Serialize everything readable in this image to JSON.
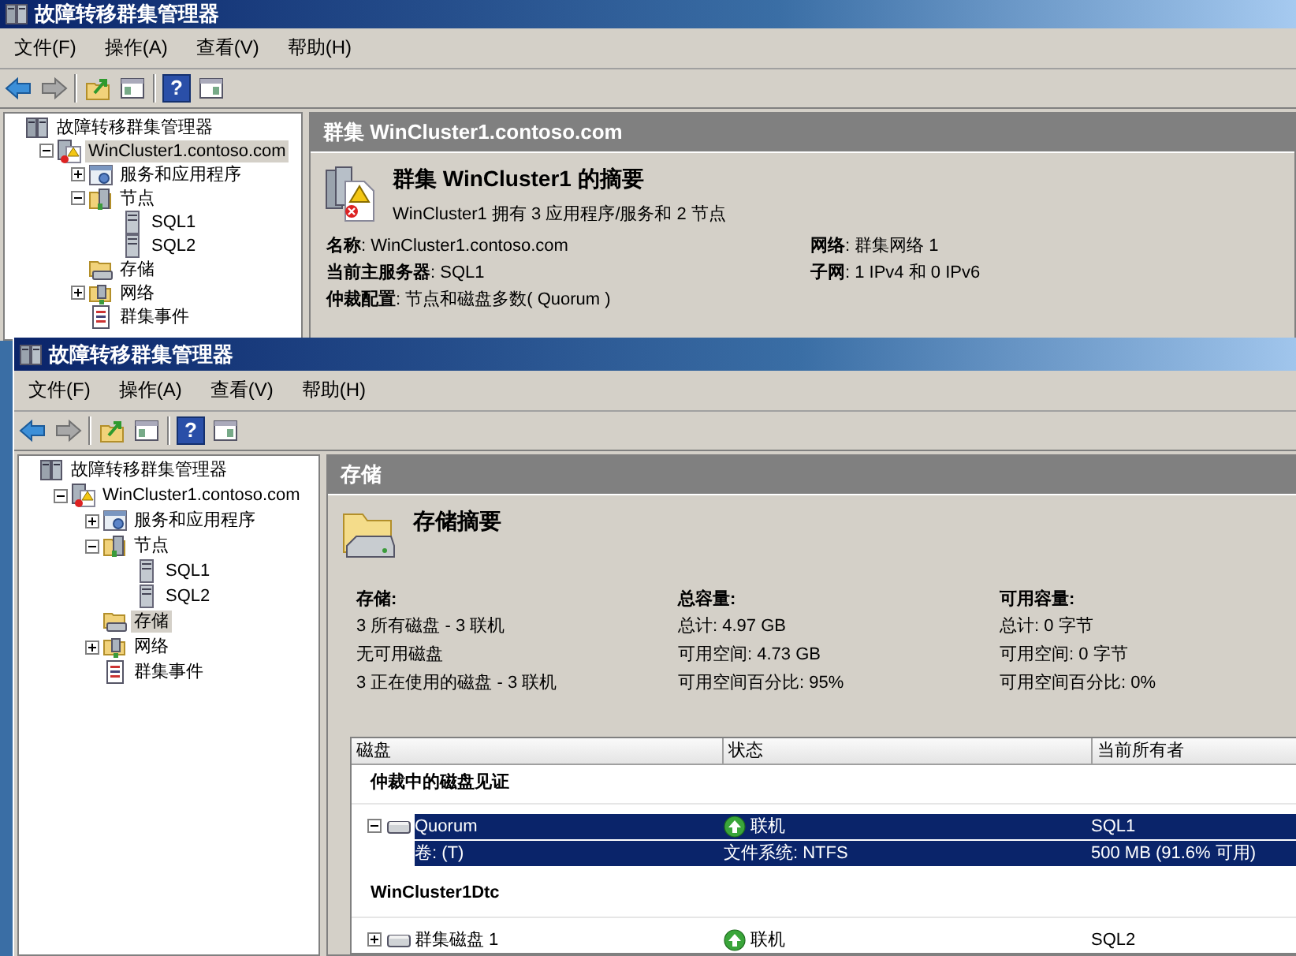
{
  "windows": [
    {
      "title": "故障转移群集管理器",
      "menu": [
        "文件(F)",
        "操作(A)",
        "查看(V)",
        "帮助(H)"
      ],
      "toolbar": [
        {
          "kind": "back"
        },
        {
          "kind": "forward"
        },
        {
          "kind": "sep"
        },
        {
          "kind": "up"
        },
        {
          "kind": "tree"
        },
        {
          "kind": "sep"
        },
        {
          "kind": "help",
          "label": "?"
        },
        {
          "kind": "actions"
        }
      ],
      "tree": [
        {
          "label": "故障转移群集管理器",
          "kind": "manager",
          "selected": false,
          "children": [
            {
              "label": "WinCluster1.contoso.com",
              "kind": "cluster",
              "expanded": true,
              "selected": true,
              "children": [
                {
                  "label": "服务和应用程序",
                  "kind": "services",
                  "expanded": false,
                  "selected": false
                },
                {
                  "label": "节点",
                  "kind": "nodes",
                  "expanded": true,
                  "selected": false,
                  "children": [
                    {
                      "label": "SQL1",
                      "kind": "server",
                      "selected": false
                    },
                    {
                      "label": "SQL2",
                      "kind": "server",
                      "selected": false
                    }
                  ]
                },
                {
                  "label": "存储",
                  "kind": "storage",
                  "selected": false
                },
                {
                  "label": "网络",
                  "kind": "network",
                  "expanded": false,
                  "selected": false
                },
                {
                  "label": "群集事件",
                  "kind": "events",
                  "selected": false
                }
              ]
            }
          ]
        }
      ],
      "pane": {
        "kind": "cluster",
        "header": "群集 WinCluster1.contoso.com",
        "summary_title": "群集 WinCluster1 的摘要",
        "summary_subtitle": "WinCluster1 拥有 3 应用程序/服务和 2 节点",
        "fields": [
          [
            "**名称**: WinCluster1.contoso.com",
            "**当前主服务器**: SQL1",
            "**仲裁配置**: 节点和磁盘多数( Quorum )"
          ],
          [
            "**网络**: 群集网络 1",
            "**子网**: 1 IPv4 和 0 IPv6"
          ]
        ]
      }
    },
    {
      "title": "故障转移群集管理器",
      "menu": [
        "文件(F)",
        "操作(A)",
        "查看(V)",
        "帮助(H)"
      ],
      "toolbar": [
        {
          "kind": "back"
        },
        {
          "kind": "forward"
        },
        {
          "kind": "sep"
        },
        {
          "kind": "up"
        },
        {
          "kind": "tree"
        },
        {
          "kind": "sep"
        },
        {
          "kind": "help",
          "label": "?"
        },
        {
          "kind": "actions"
        }
      ],
      "tree": [
        {
          "label": "故障转移群集管理器",
          "kind": "manager",
          "selected": false,
          "children": [
            {
              "label": "WinCluster1.contoso.com",
              "kind": "cluster",
              "expanded": true,
              "selected": false,
              "children": [
                {
                  "label": "服务和应用程序",
                  "kind": "services",
                  "expanded": false,
                  "selected": false
                },
                {
                  "label": "节点",
                  "kind": "nodes",
                  "expanded": true,
                  "selected": false,
                  "children": [
                    {
                      "label": "SQL1",
                      "kind": "server",
                      "selected": false
                    },
                    {
                      "label": "SQL2",
                      "kind": "server",
                      "selected": false
                    }
                  ]
                },
                {
                  "label": "存储",
                  "kind": "storage",
                  "selected": true
                },
                {
                  "label": "网络",
                  "kind": "network",
                  "expanded": false,
                  "selected": false
                },
                {
                  "label": "群集事件",
                  "kind": "events",
                  "selected": false
                }
              ]
            }
          ]
        }
      ],
      "pane": {
        "kind": "storage",
        "header": "存储",
        "summary_title": "存储摘要",
        "columns": [
          {
            "heading": "存储:",
            "lines": [
              "3 所有磁盘 - 3 联机",
              "无可用磁盘",
              "3 正在使用的磁盘 - 3 联机"
            ]
          },
          {
            "heading": "总容量:",
            "lines": [
              "总计: 4.97 GB",
              "可用空间: 4.73 GB",
              "可用空间百分比: 95%"
            ]
          },
          {
            "heading": "可用容量:",
            "lines": [
              "总计: 0 字节",
              "可用空间: 0 字节",
              "可用空间百分比: 0%"
            ]
          }
        ],
        "table": {
          "columns": [
            "磁盘",
            "状态",
            "当前所有者"
          ],
          "groups": [
            {
              "title": "仲裁中的磁盘见证",
              "rows": [
                {
                  "name": "Quorum",
                  "status": "联机",
                  "owner": "SQL1",
                  "expanded": true,
                  "selected": true,
                  "details": [
                    "卷: (T)",
                    "文件系统: NTFS",
                    "500 MB (91.6% 可用)"
                  ]
                }
              ]
            },
            {
              "title": "WinCluster1Dtc",
              "rows": [
                {
                  "name": "群集磁盘 1",
                  "status": "联机",
                  "owner": "SQL2",
                  "expanded": false,
                  "selected": false
                }
              ]
            }
          ]
        }
      }
    }
  ]
}
